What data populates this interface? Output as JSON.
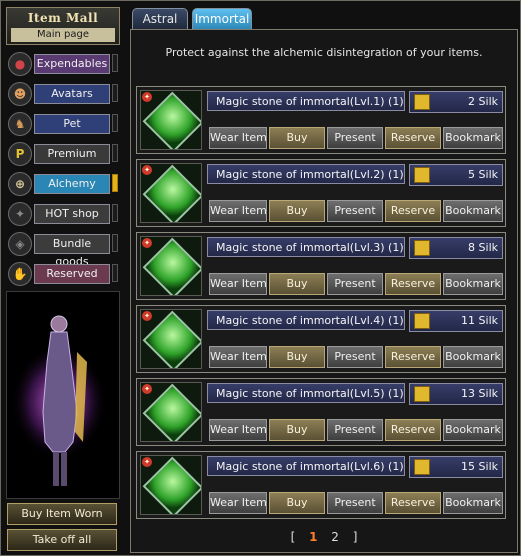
{
  "header": {
    "title": "Item Mall",
    "subtitle": "Main page"
  },
  "categories": [
    {
      "label": "Expendables",
      "icon": "potion-icon",
      "icon_glyph": "●",
      "icon_color": "#d1454a",
      "btn_bg": "#5a3a72",
      "active": false
    },
    {
      "label": "Avatars",
      "icon": "avatar-icon",
      "icon_glyph": "☻",
      "icon_color": "#e0a060",
      "btn_bg": "#2f3f78",
      "active": false
    },
    {
      "label": "Pet",
      "icon": "pet-icon",
      "icon_glyph": "♞",
      "icon_color": "#d89b5c",
      "btn_bg": "#2f3f78",
      "active": false
    },
    {
      "label": "Premium",
      "icon": "premium-icon",
      "icon_glyph": "P",
      "icon_color": "#e2c234",
      "btn_bg": "#3a3a3a",
      "active": false
    },
    {
      "label": "Alchemy",
      "icon": "alchemy-icon",
      "icon_glyph": "⊕",
      "icon_color": "#d6c79a",
      "btn_bg": "#2a86b4",
      "active": true
    },
    {
      "label": "HOT shop",
      "icon": "hot-shop-icon",
      "icon_glyph": "✦",
      "icon_color": "#8a8a8a",
      "btn_bg": "#3c3c3c",
      "active": false
    },
    {
      "label": "Bundle goods",
      "icon": "bundle-icon",
      "icon_glyph": "◈",
      "icon_color": "#8a8a8a",
      "btn_bg": "#3c3c3c",
      "active": false
    },
    {
      "label": "Reserved",
      "icon": "reserved-icon",
      "icon_glyph": "✋",
      "icon_color": "#e07848",
      "btn_bg": "#6b3a4e",
      "active": false
    }
  ],
  "side_buttons": {
    "buy_worn": "Buy Item Worn",
    "take_off": "Take off all"
  },
  "tabs": [
    {
      "label": "Astral",
      "active": false
    },
    {
      "label": "Immortal",
      "active": true
    }
  ],
  "info_text": "Protect against the alchemic disintegration of your items.",
  "items": [
    {
      "name": "Magic stone of immortal(Lvl.1) (1)",
      "price": "2  Silk"
    },
    {
      "name": "Magic stone of immortal(Lvl.2) (1)",
      "price": "5  Silk"
    },
    {
      "name": "Magic stone of immortal(Lvl.3) (1)",
      "price": "8  Silk"
    },
    {
      "name": "Magic stone of immortal(Lvl.4) (1)",
      "price": "11  Silk"
    },
    {
      "name": "Magic stone of immortal(Lvl.5) (1)",
      "price": "13  Silk"
    },
    {
      "name": "Magic stone of immortal(Lvl.6) (1)",
      "price": "15  Silk"
    }
  ],
  "actions": {
    "wear": "Wear Item",
    "buy": "Buy",
    "present": "Present",
    "reserve": "Reserve",
    "bookmark": "Bookmark"
  },
  "pagination": {
    "open": "[",
    "pages": [
      "1",
      "2"
    ],
    "current": "1",
    "close": "]"
  }
}
